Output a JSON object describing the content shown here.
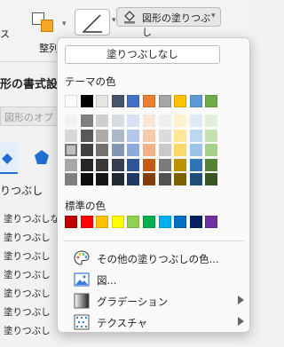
{
  "ribbon": {
    "arrange_label": "整列",
    "fill_button_label": "図形の塗りつぶし"
  },
  "pane": {
    "title": "形の書式設",
    "search_placeholder": "図形のオプ",
    "section_label": "りつぶし",
    "radio_items": [
      "塗りつぶしな",
      "塗りつぶし",
      "塗りつぶし",
      "塗りつぶし",
      "塗りつぶし",
      "塗りつぶし",
      "塗りつぶし"
    ]
  },
  "popup": {
    "no_fill_label": "塗りつぶしなし",
    "theme_colors_title": "テーマの色",
    "standard_colors_title": "標準の色",
    "theme_colors": [
      "#FFFFFF",
      "#000000",
      "#E7E6E6",
      "#44546A",
      "#4472C4",
      "#ED7D31",
      "#A5A5A5",
      "#FFC000",
      "#5B9BD5",
      "#70AD47"
    ],
    "theme_shades": [
      [
        "#F2F2F2",
        "#D9D9D9",
        "#BFBFBF",
        "#A6A6A6",
        "#7F7F7F"
      ],
      [
        "#7F7F7F",
        "#595959",
        "#404040",
        "#262626",
        "#0D0D0D"
      ],
      [
        "#D0CECE",
        "#AEAAAA",
        "#757171",
        "#3B3838",
        "#171616"
      ],
      [
        "#D6DCE4",
        "#ADB9CA",
        "#8497B0",
        "#333F4F",
        "#222A35"
      ],
      [
        "#D9E2F3",
        "#B4C6E7",
        "#8EAADB",
        "#2F5496",
        "#1F3864"
      ],
      [
        "#FBE5D5",
        "#F7CAAC",
        "#F4B183",
        "#C55A11",
        "#843C0B"
      ],
      [
        "#EDEDED",
        "#DBDBDB",
        "#C9C9C9",
        "#7B7B7B",
        "#525252"
      ],
      [
        "#FFF2CC",
        "#FFE699",
        "#FFD966",
        "#BF9000",
        "#7F6000"
      ],
      [
        "#DEEBF6",
        "#BDD7EE",
        "#9DC3E6",
        "#2E75B5",
        "#1F4E79"
      ],
      [
        "#E2EFD9",
        "#C5E0B3",
        "#A8D08D",
        "#538135",
        "#375623"
      ]
    ],
    "standard_colors": [
      "#C00000",
      "#FF0000",
      "#FFC000",
      "#FFFF00",
      "#92D050",
      "#00B050",
      "#00B0F0",
      "#0070C0",
      "#002060",
      "#7030A0"
    ],
    "menu": {
      "more_colors": "その他の塗りつぶしの色...",
      "picture": "図...",
      "gradient": "グラデーション",
      "texture": "テクスチャ"
    }
  }
}
